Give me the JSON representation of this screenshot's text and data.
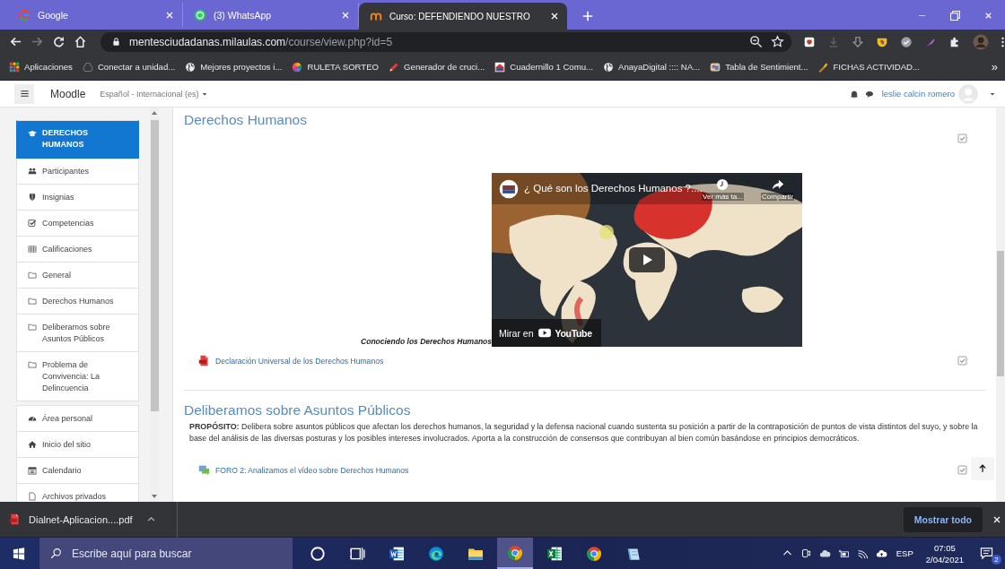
{
  "browser": {
    "tabs": [
      {
        "title": "Google",
        "kind": "google",
        "selected": false
      },
      {
        "title": "(3) WhatsApp",
        "kind": "whatsapp",
        "selected": false
      },
      {
        "title": "Curso: DEFENDIENDO NUESTRO",
        "kind": "moodle",
        "selected": true
      }
    ],
    "address": {
      "domain": "mentesciudadanas.milaulas.com",
      "path": "/course/view.php?id=5"
    },
    "bookmarks": [
      {
        "label": "Aplicaciones",
        "kind": "apps"
      },
      {
        "label": "Conectar a unidad...",
        "kind": "drive"
      },
      {
        "label": "Mejores proyectos i...",
        "kind": "globe"
      },
      {
        "label": "RULETA SORTEO",
        "kind": "wheel"
      },
      {
        "label": "Generador de cruci...",
        "kind": "pencil"
      },
      {
        "label": "Cuadernillo 1 Comu...",
        "kind": "house"
      },
      {
        "label": "AnayaDigital :::: NA...",
        "kind": "globe"
      },
      {
        "label": "Tabla de Sentimient...",
        "kind": "thumb"
      },
      {
        "label": "FICHAS ACTIVIDAD...",
        "kind": "brush"
      }
    ],
    "bookmarks_more": "»"
  },
  "moodle_bar": {
    "site": "Moodle",
    "language": "Español - Internacional (es)",
    "user": "leslie calcin romero"
  },
  "sidebar": {
    "groups": [
      [
        {
          "label": "DERECHOS HUMANOS",
          "kind": "cap",
          "selected": true
        },
        {
          "label": "Participantes",
          "kind": "users",
          "selected": false
        },
        {
          "label": "Insignias",
          "kind": "shield",
          "selected": false
        },
        {
          "label": "Competencias",
          "kind": "check",
          "selected": false
        },
        {
          "label": "Calificaciones",
          "kind": "table",
          "selected": false
        },
        {
          "label": "General",
          "kind": "folder",
          "selected": false
        },
        {
          "label": "Derechos Humanos",
          "kind": "folder",
          "selected": false
        },
        {
          "label": "Deliberamos sobre Asuntos Públicos",
          "kind": "folder",
          "selected": false
        },
        {
          "label": "Problema de Convivencia: La Delincuencia",
          "kind": "folder",
          "selected": false
        }
      ],
      [
        {
          "label": "Área personal",
          "kind": "gauge",
          "selected": false
        },
        {
          "label": "Inicio del sitio",
          "kind": "home",
          "selected": false
        },
        {
          "label": "Calendario",
          "kind": "calendar",
          "selected": false
        },
        {
          "label": "Archivos privados",
          "kind": "file",
          "selected": false
        }
      ]
    ]
  },
  "sections": [
    {
      "title": "Derechos Humanos",
      "activities": [
        {
          "kind": "video",
          "completed": true,
          "caption": "Conociendo los Derechos Humanos",
          "video_title": "¿ Qué son los Derechos Humanos ?....",
          "watch_later": "Ver más ta...",
          "share": "Compartir",
          "watch_on": "Mirar en",
          "brand": "YouTube"
        },
        {
          "kind": "resource",
          "completed": true,
          "label": "Declaración Universal de los Derechos Humanos"
        }
      ]
    },
    {
      "title": "Deliberamos sobre Asuntos Públicos",
      "summary": "**PROPÓSITO:** Delibera sobre asuntos públicos que afectan los derechos humanos, la seguridad y la defensa nacional cuando sustenta su posición a partir de la contraposición de puntos de vista distintos del suyo, y sobre la base del análisis de las diversas posturas y los posibles intereses involucrados. Aporta a la construcción de consensos que contribuyan al bien común basándose en principios democráticos.",
      "activities": [
        {
          "kind": "forum",
          "completed": true,
          "label": "FORO 2: Analizamos el vídeo sobre Derechos Humanos"
        }
      ]
    }
  ],
  "download_bar": {
    "file": "Dialnet-Aplicacion....pdf",
    "show_all": "Mostrar todo"
  },
  "taskbar": {
    "search_placeholder": "Escribe aquí para buscar",
    "apps": [
      {
        "kind": "cortana",
        "selected": false
      },
      {
        "kind": "taskview",
        "selected": false
      },
      {
        "kind": "word",
        "selected": false
      },
      {
        "kind": "edge",
        "selected": false
      },
      {
        "kind": "explorer",
        "selected": false
      },
      {
        "kind": "chrome",
        "selected": true
      },
      {
        "kind": "excel",
        "selected": false
      },
      {
        "kind": "chrome",
        "selected": false
      },
      {
        "kind": "notepad",
        "selected": false
      }
    ],
    "tray": {
      "language": "ESP",
      "time": "07:05",
      "date": "2/04/2021",
      "notifications": "2"
    }
  }
}
